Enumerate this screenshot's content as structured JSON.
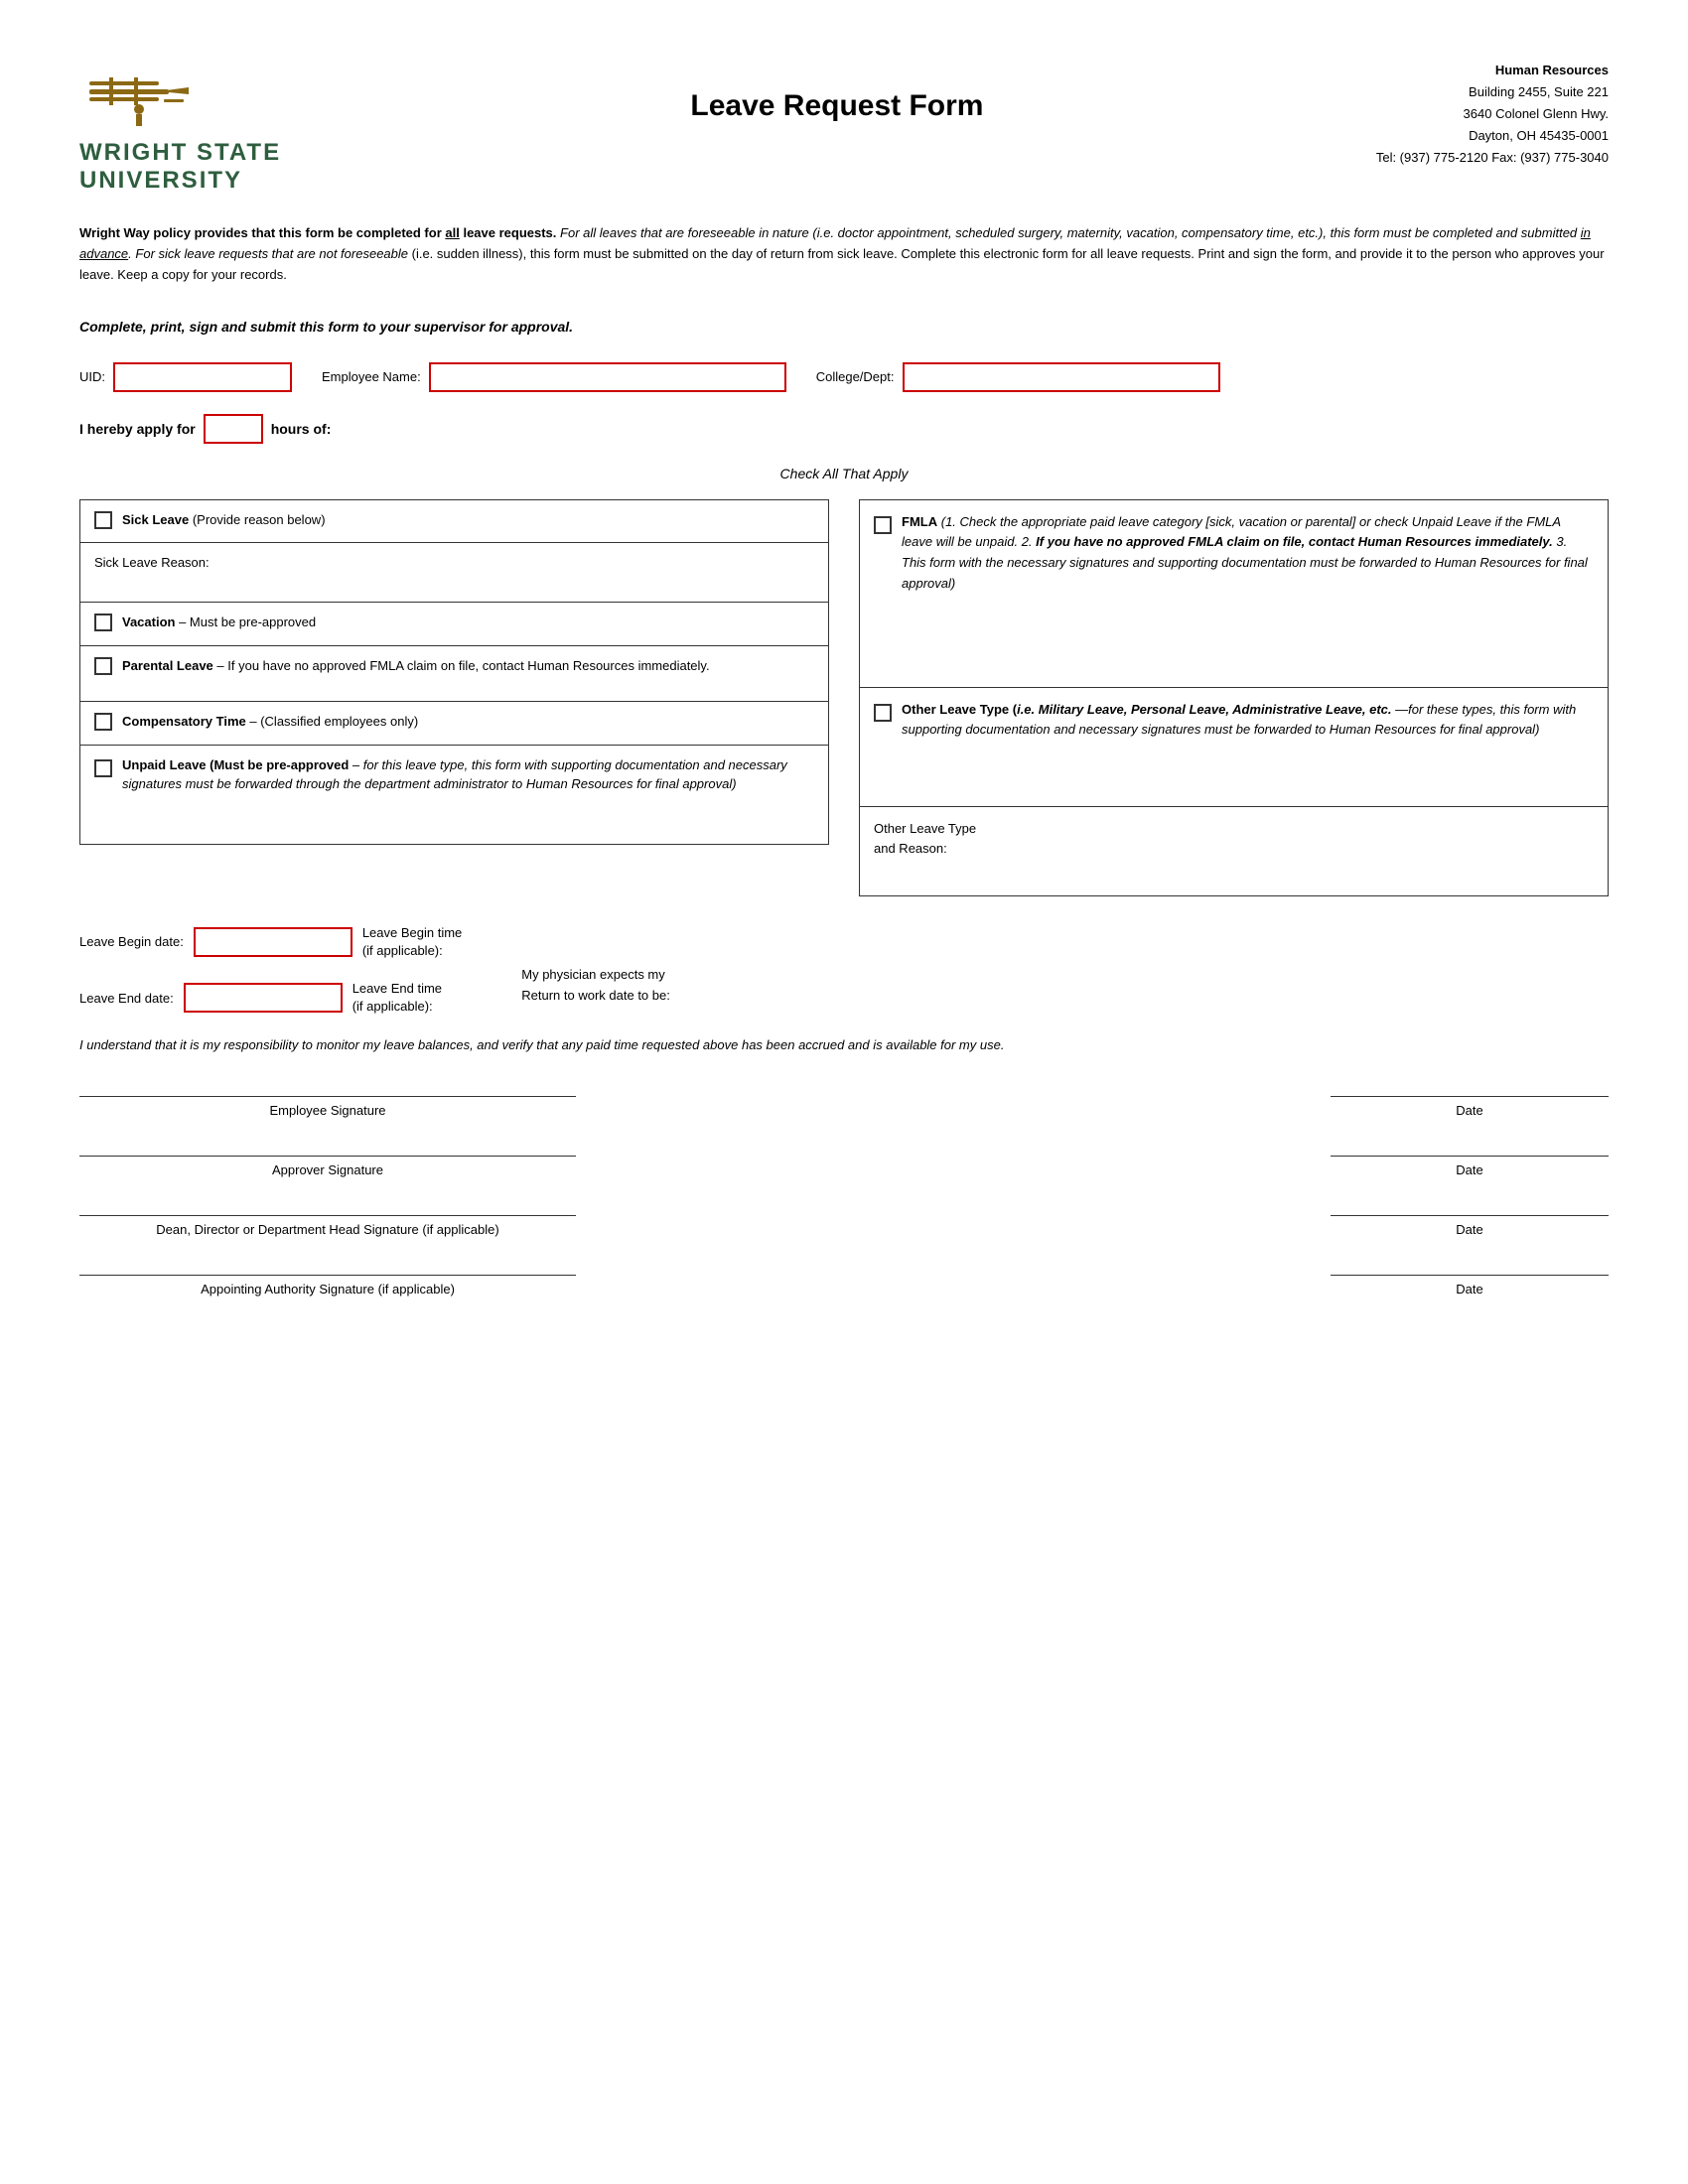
{
  "header": {
    "university_name_line1": "WRIGHT STATE",
    "university_name_line2": "UNIVERSITY",
    "form_title": "Leave Request Form",
    "hr": {
      "department": "Human Resources",
      "address1": "Building 2455, Suite 221",
      "address2": "3640 Colonel Glenn Hwy.",
      "address3": "Dayton, OH 45435-0001",
      "tel": "Tel: (937) 775-2120  Fax: (937) 775-3040"
    }
  },
  "policy": {
    "text1": "Wright Way policy provides that this form be completed for ",
    "underline1": "all",
    "text2": " leave requests.",
    "italic1": " For all leaves that are foreseeable in nature (i.e. doctor appointment, scheduled surgery, maternity, vacation, compensatory time, etc.), this form must be completed and submitted ",
    "underline2": "in advance",
    "italic2": ".  For sick leave requests that are not foreseeable",
    "text3": " (i.e. sudden illness), this form must be submitted on the day of return from sick leave.  Complete this electronic form for all leave requests.  Print and sign the form, and provide it to the person who approves your leave.  Keep a copy for your records."
  },
  "submit_instruction": "Complete, print, sign and submit this form to your supervisor for approval.",
  "fields": {
    "uid_label": "UID:",
    "uid_placeholder": "",
    "employee_name_label": "Employee Name:",
    "employee_name_placeholder": "",
    "college_dept_label": "College/Dept:",
    "college_dept_placeholder": "",
    "apply_for_label": "I hereby apply for",
    "hours_label": "hours of:",
    "hours_placeholder": ""
  },
  "check_all": "Check All That Apply",
  "leave_types": {
    "sick_leave": {
      "label": "Sick Leave",
      "detail": " (Provide reason below)"
    },
    "sick_leave_reason": {
      "label": "Sick Leave Reason:"
    },
    "vacation": {
      "label": "Vacation",
      "detail": " – Must be pre-approved"
    },
    "parental": {
      "label": "Parental Leave",
      "detail": " – If you have no approved FMLA claim on file, contact Human Resources immediately."
    },
    "compensatory": {
      "label": "Compensatory Time",
      "detail": " – (Classified employees only)"
    },
    "unpaid": {
      "label_bold": "Unpaid Leave (Must be pre-approved",
      "detail": " – for this leave type, this form with supporting documentation and necessary signatures must be forwarded through the department administrator to Human Resources for final approval)"
    }
  },
  "right_types": {
    "fmla": {
      "label_bold": "FMLA",
      "detail": " (1. Check the appropriate paid leave category [sick, vacation or parental] or check Unpaid Leave if the FMLA leave will be unpaid.  2. ",
      "bold2": "If you have no approved FMLA claim on file, contact Human Resources immediately.",
      "detail2": "  3. This form with the necessary signatures and supporting documentation must be forwarded to Human Resources for final approval)"
    },
    "other": {
      "label_bold": "Other Leave Type (",
      "italic1": "i.e. Military Leave, Personal Leave, Administrative Leave, etc.",
      "detail": "—for these types, this form with supporting documentation and necessary signatures must be forwarded to Human Resources for final approval)"
    },
    "other_reason": {
      "label": "Other Leave Type",
      "label2": "and Reason:"
    }
  },
  "dates": {
    "begin_label": "Leave Begin date:",
    "begin_time_label": "Leave Begin time\n(if applicable):",
    "end_label": "Leave End date:",
    "end_time_label": "Leave End time\n(if applicable):",
    "physician": "My physician expects my\nReturn to work date to be:"
  },
  "understand_text": "I understand that it is my responsibility to monitor my leave balances, and verify that any paid time requested above has been accrued and is available for my use.",
  "signatures": [
    {
      "line_label": "Employee Signature",
      "date_label": "Date"
    },
    {
      "line_label": "Approver Signature",
      "date_label": "Date"
    },
    {
      "line_label": "Dean, Director or Department Head Signature (if applicable)",
      "date_label": "Date"
    },
    {
      "line_label": "Appointing Authority Signature (if applicable)",
      "date_label": "Date"
    }
  ]
}
